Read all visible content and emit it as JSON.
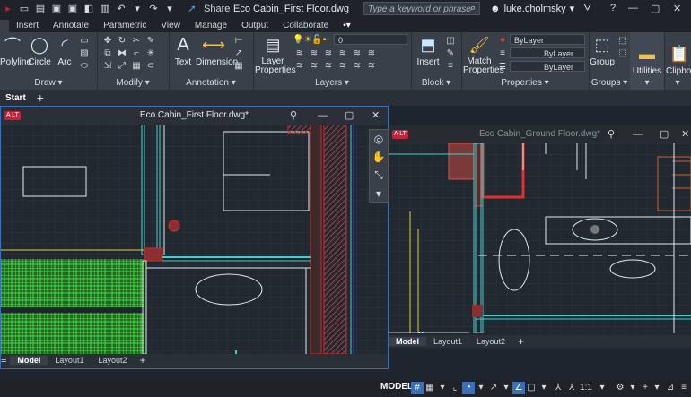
{
  "qat": {
    "share_label": "Share",
    "title": "Eco Cabin_First Floor.dwg",
    "search_placeholder": "Type a keyword or phrase",
    "user": "luke.cholmsky"
  },
  "ribbon_tabs": [
    "Insert",
    "Annotate",
    "Parametric",
    "View",
    "Manage",
    "Output",
    "Collaborate"
  ],
  "ribbon": {
    "draw": {
      "label": "Draw",
      "polyline": "Polyline",
      "circle": "Circle",
      "arc": "Arc"
    },
    "modify": {
      "label": "Modify"
    },
    "annotation": {
      "label": "Annotation",
      "text": "Text",
      "dimension": "Dimension"
    },
    "layers": {
      "label": "Layers",
      "properties": "Layer\nProperties",
      "current_layer": "0"
    },
    "block": {
      "label": "Block",
      "insert": "Insert"
    },
    "properties": {
      "label": "Properties",
      "match": "Match\nProperties",
      "color": "ByLayer",
      "linetype": "ByLayer",
      "lineweight": "ByLayer"
    },
    "groups": {
      "label": "Groups",
      "group": "Group"
    },
    "utilities": {
      "label": "Utilities"
    },
    "clipboard": {
      "label": "Clipboa"
    }
  },
  "doc_tabs": {
    "start": "Start"
  },
  "windows": {
    "first": {
      "title": "Eco Cabin_First Floor.dwg*",
      "layouts": [
        "Model",
        "Layout1",
        "Layout2"
      ]
    },
    "ground": {
      "title": "Eco Cabin_Ground Floor.dwg*",
      "layouts": [
        "Model",
        "Layout1",
        "Layout2"
      ]
    }
  },
  "status": {
    "model": "MODEL",
    "scale": "1:1"
  },
  "colors": {
    "accent": "#3b6fb6",
    "brand": "#c4213b"
  }
}
